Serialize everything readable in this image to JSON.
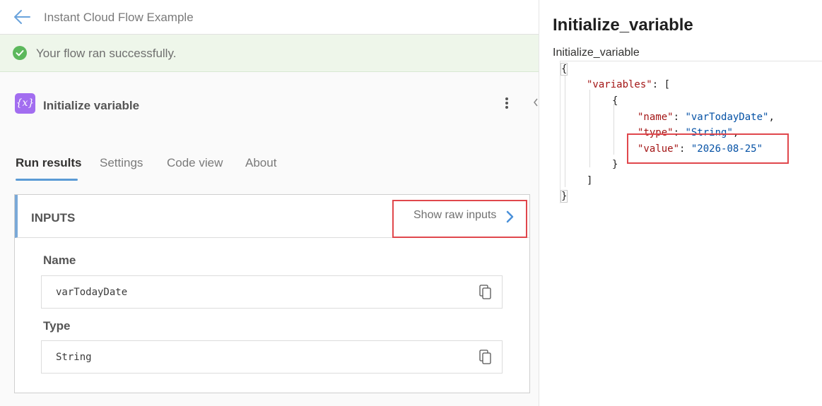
{
  "header": {
    "title": "Instant Cloud Flow Example",
    "back_icon": "arrow-left-icon"
  },
  "banner": {
    "text": "Your flow ran successfully.",
    "icon": "check-circle-icon",
    "color": "#5cb85c"
  },
  "action": {
    "icon_text": "{x}",
    "title": "Initialize variable",
    "icon_color": "#a26df0"
  },
  "tabs": [
    {
      "label": "Run results",
      "active": true
    },
    {
      "label": "Settings",
      "active": false
    },
    {
      "label": "Code view",
      "active": false
    },
    {
      "label": "About",
      "active": false
    }
  ],
  "inputs": {
    "title": "INPUTS",
    "show_raw_label": "Show raw inputs",
    "fields": [
      {
        "label": "Name",
        "value": "varTodayDate"
      },
      {
        "label": "Type",
        "value": "String"
      }
    ]
  },
  "panel": {
    "title": "Initialize_variable",
    "subtitle": "Initialize_variable",
    "json": {
      "open_brace": "{",
      "variables_key": "\"variables\"",
      "open_bracket": "[",
      "inner_open": "{",
      "name_key": "\"name\"",
      "name_value": "\"varTodayDate\"",
      "type_key": "\"type\"",
      "type_value": "\"String\"",
      "value_key": "\"value\"",
      "value_value": "\"2026-08-25\"",
      "inner_close": "}",
      "close_bracket": "]",
      "close_brace": "}"
    }
  },
  "colors": {
    "accent": "#5b9bd5",
    "highlight": "#e0474c",
    "json_key": "#a31515",
    "json_string": "#0451a5"
  }
}
